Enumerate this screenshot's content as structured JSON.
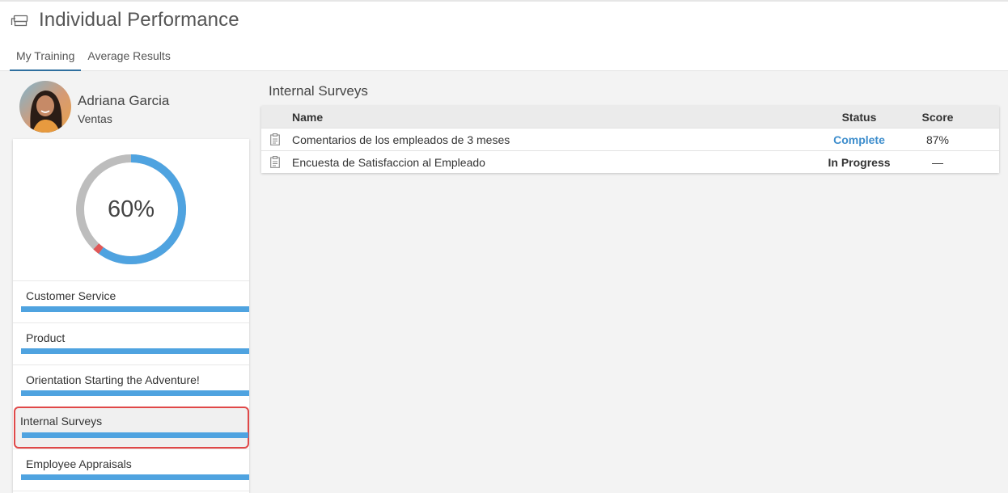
{
  "header": {
    "icon": "graduation-cap-icon",
    "title": "Individual Performance"
  },
  "tabs": [
    {
      "label": "My Training",
      "active": true
    },
    {
      "label": "Average Results",
      "active": false
    }
  ],
  "user": {
    "name": "Adriana Garcia",
    "department": "Ventas"
  },
  "progress": {
    "percent_label": "60%",
    "segments": {
      "completed": 0.6,
      "remaining": 0.38,
      "failed": 0.02
    },
    "colors": {
      "completed": "#4fa3e0",
      "remaining": "#bdbdbd",
      "failed": "#e05757"
    }
  },
  "courses": [
    {
      "label": "Customer Service",
      "progress": 1.0,
      "selected": false
    },
    {
      "label": "Product",
      "progress": 1.0,
      "selected": false
    },
    {
      "label": "Orientation Starting the Adventure!",
      "progress": 1.0,
      "selected": false
    },
    {
      "label": "Internal Surveys",
      "progress": 1.0,
      "selected": true
    },
    {
      "label": "Employee Appraisals",
      "progress": 1.0,
      "selected": false
    }
  ],
  "detail": {
    "title": "Internal Surveys",
    "columns": {
      "name": "Name",
      "status": "Status",
      "score": "Score"
    },
    "rows": [
      {
        "icon": "clipboard-icon",
        "name": "Comentarios de los empleados de 3 meses",
        "status": "Complete",
        "score": "87%"
      },
      {
        "icon": "clipboard-icon",
        "name": "Encuesta de Satisfaccion al Empleado",
        "status": "In Progress",
        "score": "—"
      }
    ]
  },
  "colors": {
    "accent": "#4fa3e0",
    "selection_border": "#e04848",
    "status_complete": "#3d8dcc"
  }
}
